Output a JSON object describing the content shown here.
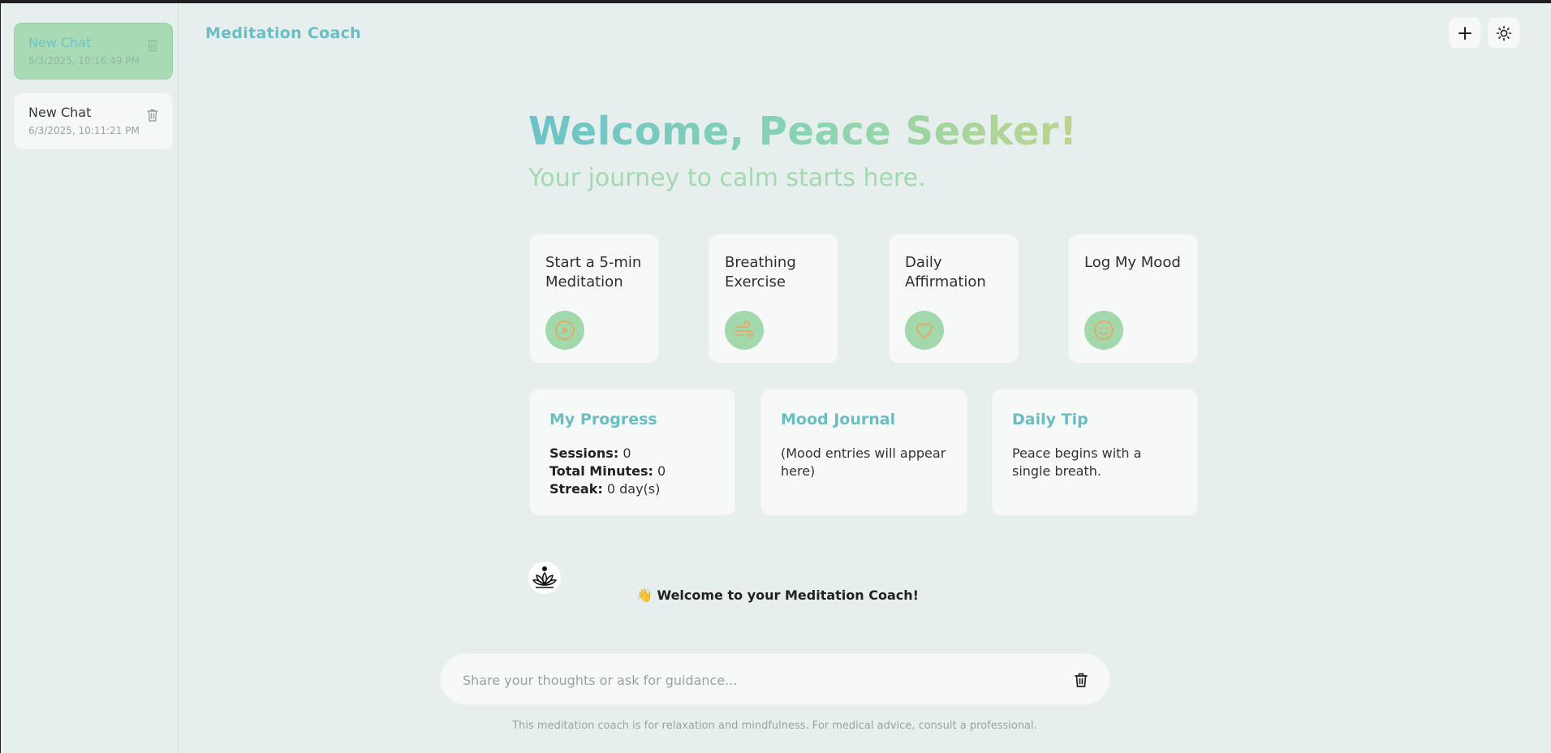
{
  "sidebar": {
    "chats": [
      {
        "title": "New Chat",
        "date": "6/3/2025, 10:16:49 PM",
        "active": true
      },
      {
        "title": "New Chat",
        "date": "6/3/2025, 10:11:21 PM",
        "active": false
      }
    ]
  },
  "header": {
    "title": "Meditation Coach",
    "new_chat_icon": "plus-icon",
    "theme_icon": "sun-icon"
  },
  "hero": {
    "title": "Welcome, Peace Seeker!",
    "subtitle": "Your journey to calm starts here."
  },
  "actions": [
    {
      "label": "Start a 5-min Meditation",
      "icon": "play-icon"
    },
    {
      "label": "Breathing Exercise",
      "icon": "wind-icon"
    },
    {
      "label": "Daily Affirmation",
      "icon": "heart-icon"
    },
    {
      "label": "Log My Mood",
      "icon": "smile-icon"
    }
  ],
  "progress": {
    "title": "My Progress",
    "sessions_label": "Sessions:",
    "sessions_value": "0",
    "minutes_label": "Total Minutes:",
    "minutes_value": "0",
    "streak_label": "Streak:",
    "streak_value": "0 day(s)"
  },
  "mood_journal": {
    "title": "Mood Journal",
    "body": "(Mood entries will appear here)"
  },
  "daily_tip": {
    "title": "Daily Tip",
    "body": "Peace begins with a single breath."
  },
  "chat": {
    "bot_icon": "lotus-icon",
    "welcome_message": "👋 Welcome to your Meditation Coach!"
  },
  "input": {
    "placeholder": "Share your thoughts or ask for guidance...",
    "value": ""
  },
  "footer": {
    "disclaimer": "This meditation coach is for relaxation and mindfulness. For medical advice, consult a professional."
  },
  "colors": {
    "accent_teal": "#6bbdc4",
    "accent_green": "#a2d8ac",
    "icon_orange": "#e8a860",
    "background": "#e6efee"
  }
}
